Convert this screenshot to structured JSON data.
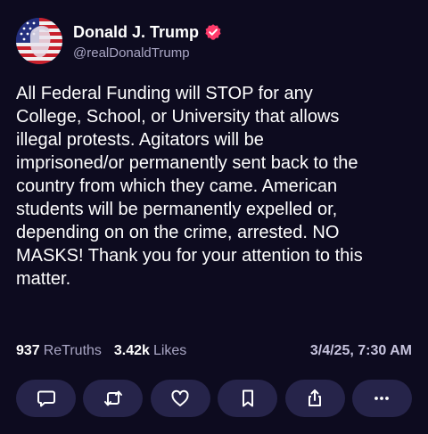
{
  "author": {
    "display_name": "Donald J. Trump",
    "handle": "@realDonaldTrump",
    "verified": true,
    "verified_color": "#ff3b6b"
  },
  "post": {
    "text": "All Federal Funding will STOP for any\nCollege, School, or University that allows\nillegal protests. Agitators will be\nimprisoned/or permanently sent back to the\ncountry from which they came. American\nstudents will be permanently expelled or,\ndepending on on the crime, arrested. NO\nMASKS! Thank you for your attention to this\nmatter."
  },
  "stats": {
    "retruths_count": "937",
    "retruths_label": "ReTruths",
    "likes_count": "3.42k",
    "likes_label": "Likes",
    "timestamp": "3/4/25, 7:30 AM"
  },
  "actions": [
    {
      "name": "reply",
      "icon": "speech-bubble-icon"
    },
    {
      "name": "retruth",
      "icon": "retruth-arrows-icon"
    },
    {
      "name": "like",
      "icon": "heart-icon"
    },
    {
      "name": "bookmark",
      "icon": "bookmark-icon"
    },
    {
      "name": "share",
      "icon": "share-upload-icon"
    },
    {
      "name": "more",
      "icon": "more-dots-icon"
    }
  ],
  "colors": {
    "background": "#0d0b1f",
    "button_background": "#26244a",
    "secondary_text": "#a9a6c4"
  }
}
